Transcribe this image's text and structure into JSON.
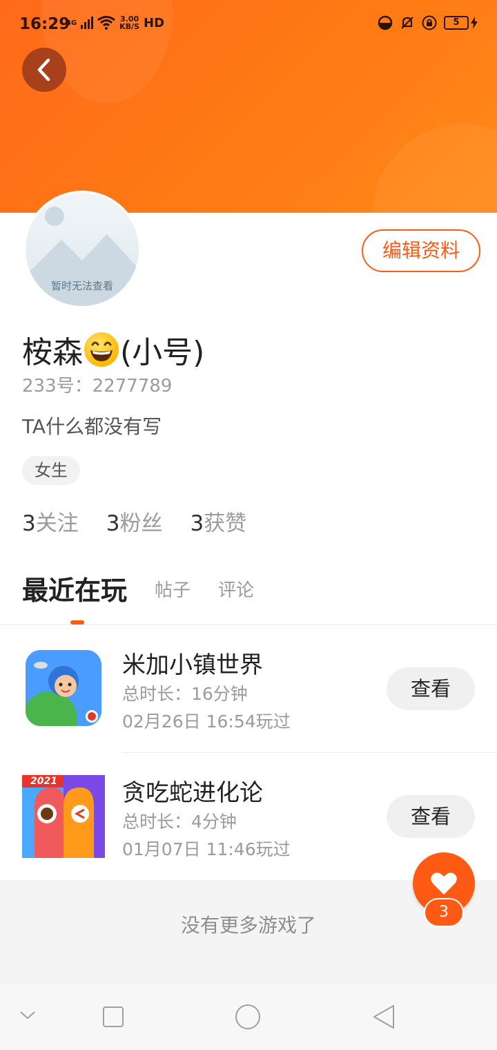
{
  "status_bar": {
    "time": "16:29",
    "network": "4G",
    "speed_value": "3.00",
    "speed_unit": "KB/S",
    "hd": "HD",
    "battery": "5"
  },
  "profile": {
    "avatar_caption": "暂时无法查看",
    "edit_label": "编辑资料",
    "name_part1": "桉森",
    "name_emoji": "grinning-face-emoji",
    "name_part2": "(小号)",
    "uid": "233号：2277789",
    "bio": "TA什么都没有写",
    "tag": "女生",
    "stats": [
      {
        "num": "3",
        "label": "关注"
      },
      {
        "num": "3",
        "label": "粉丝"
      },
      {
        "num": "3",
        "label": "获赞"
      }
    ]
  },
  "tabs": [
    {
      "label": "最近在玩"
    },
    {
      "label": "帖子"
    },
    {
      "label": "评论"
    }
  ],
  "games": [
    {
      "title": "米加小镇世界",
      "duration": "总时长：16分钟",
      "played": "02月26日 16:54玩过",
      "action": "查看"
    },
    {
      "title": "贪吃蛇进化论",
      "duration": "总时长：4分钟",
      "played": "01月07日 11:46玩过",
      "action": "查看",
      "badge": "2021"
    }
  ],
  "footer_text": "没有更多游戏了",
  "like_count": "3",
  "colors": {
    "accent": "#ff5a14",
    "header_start": "#ff6a1a",
    "header_end": "#ff8a1a"
  },
  "icons": [
    "back-icon",
    "heart-icon",
    "nav-down-icon",
    "nav-recent-icon",
    "nav-home-icon",
    "nav-back-icon"
  ]
}
